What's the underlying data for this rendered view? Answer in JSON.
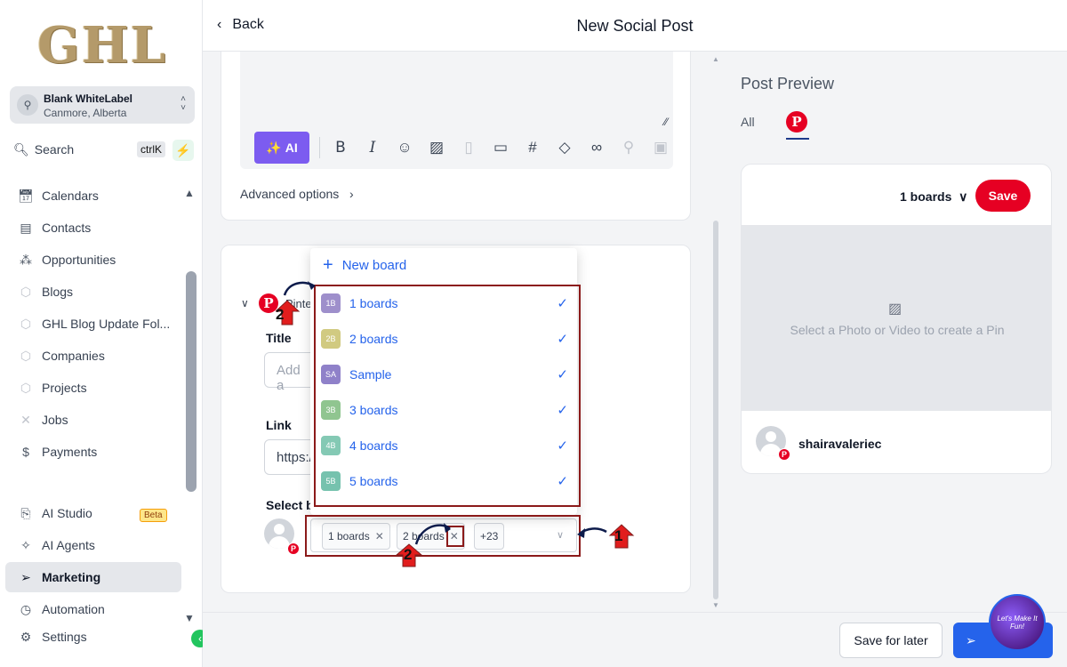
{
  "logo": "GHL",
  "account": {
    "name": "Blank WhiteLabel",
    "location": "Canmore, Alberta"
  },
  "search": {
    "label": "Search",
    "shortcut": "ctrlK"
  },
  "nav": {
    "calendars": "Calendars",
    "contacts": "Contacts",
    "opportunities": "Opportunities",
    "blogs": "Blogs",
    "blog_update": "GHL Blog Update Fol...",
    "companies": "Companies",
    "projects": "Projects",
    "jobs": "Jobs",
    "payments": "Payments",
    "ai_studio": "AI Studio",
    "ai_studio_badge": "Beta",
    "ai_agents": "AI Agents",
    "marketing": "Marketing",
    "automation": "Automation",
    "settings": "Settings"
  },
  "header": {
    "back": "Back",
    "title": "New Social Post"
  },
  "editor": {
    "ai_button": "AI",
    "advanced": "Advanced options"
  },
  "pinterest": {
    "label": "Pinte",
    "title_label": "Title",
    "title_placeholder": "Add a",
    "link_label": "Link",
    "link_value": "https:/",
    "select_label": "Select b"
  },
  "dropdown": {
    "new_board": "New board",
    "items": [
      {
        "badge": "1B",
        "label": "1 boards",
        "color": "#8e7cc3"
      },
      {
        "badge": "2B",
        "label": "2 boards",
        "color": "#c9c16b"
      },
      {
        "badge": "SA",
        "label": "Sample",
        "color": "#7c6cc0"
      },
      {
        "badge": "3B",
        "label": "3 boards",
        "color": "#7dbb7d"
      },
      {
        "badge": "4B",
        "label": "4 boards",
        "color": "#6fc0a8"
      },
      {
        "badge": "5B",
        "label": "5 boards",
        "color": "#5fb8a0"
      }
    ]
  },
  "selected": {
    "tag1": "1 boards",
    "tag2": "2 boards",
    "more": "+23"
  },
  "annotations": {
    "one": "1",
    "two": "2"
  },
  "preview": {
    "title": "Post Preview",
    "tab_all": "All",
    "boards": "1 boards",
    "save": "Save",
    "placeholder": "Select a Photo or Video to create a Pin",
    "username": "shairavaleriec"
  },
  "footer": {
    "save_later": "Save for later",
    "post": ""
  },
  "watermark": "Let's Make It Fun!",
  "colors": {
    "primary": "#2563eb",
    "pinterest": "#e60023",
    "ai": "#7c5cf0",
    "annotation": "#8b1a1a"
  }
}
